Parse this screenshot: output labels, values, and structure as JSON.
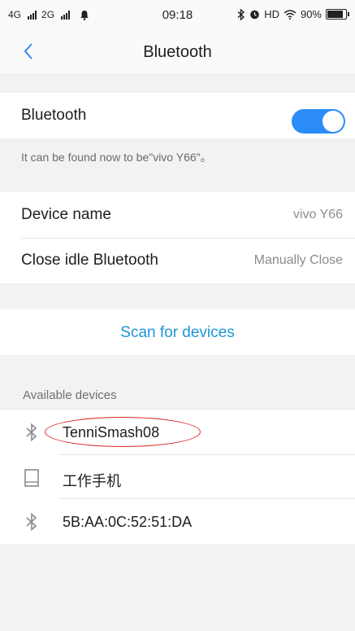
{
  "status_bar": {
    "net1": "4G",
    "net2": "2G",
    "time": "09:18",
    "hd": "HD",
    "battery": "90%",
    "battery_level": 0.9
  },
  "nav": {
    "title": "Bluetooth"
  },
  "bluetooth": {
    "label": "Bluetooth",
    "enabled": true,
    "hint": "It can be found now to be\"vivo Y66\"。"
  },
  "settings": {
    "device_name_label": "Device name",
    "device_name_value": "vivo Y66",
    "close_idle_label": "Close idle Bluetooth",
    "close_idle_value": "Manually Close"
  },
  "scan": {
    "label": "Scan for devices"
  },
  "available": {
    "header": "Available devices",
    "devices": [
      {
        "name": "TenniSmash08",
        "icon": "bluetooth-icon"
      },
      {
        "name": "工作手机",
        "icon": "phone-icon"
      },
      {
        "name": "5B:AA:0C:52:51:DA",
        "icon": "bluetooth-icon"
      }
    ]
  },
  "colors": {
    "accent": "#2b8cf7",
    "link": "#1e95d8",
    "annotation": "#dd2222"
  }
}
